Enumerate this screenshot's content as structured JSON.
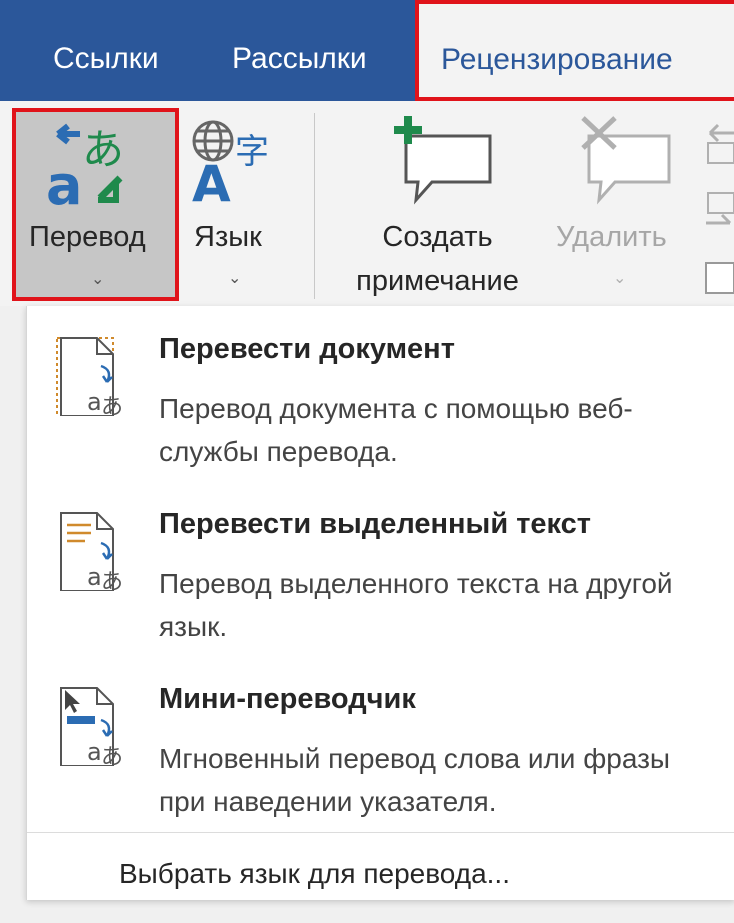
{
  "ribbon_tabs": {
    "links": "Ссылки",
    "mailings": "Рассылки",
    "review": "Рецензирование"
  },
  "ribbon": {
    "translate": {
      "label": "Перевод"
    },
    "language": {
      "label": "Язык"
    },
    "new_comment": {
      "label_line1": "Создать",
      "label_line2": "примечание"
    },
    "delete_comment": {
      "label": "Удалить"
    }
  },
  "menu": {
    "items": [
      {
        "title": "Перевести документ",
        "description": "Перевод документа с помощью веб-службы перевода."
      },
      {
        "title": "Перевести выделенный текст",
        "description": "Перевод выделенного текста на другой язык."
      },
      {
        "title": "Мини-переводчик",
        "description": "Мгновенный перевод слова или фразы при наведении указателя."
      }
    ],
    "footer": "Выбрать язык для перевода..."
  },
  "colors": {
    "tab_bar": "#2b579a",
    "highlight": "#e0131a",
    "translate_blue": "#2b6cb3",
    "translate_green": "#1f8a4c"
  }
}
